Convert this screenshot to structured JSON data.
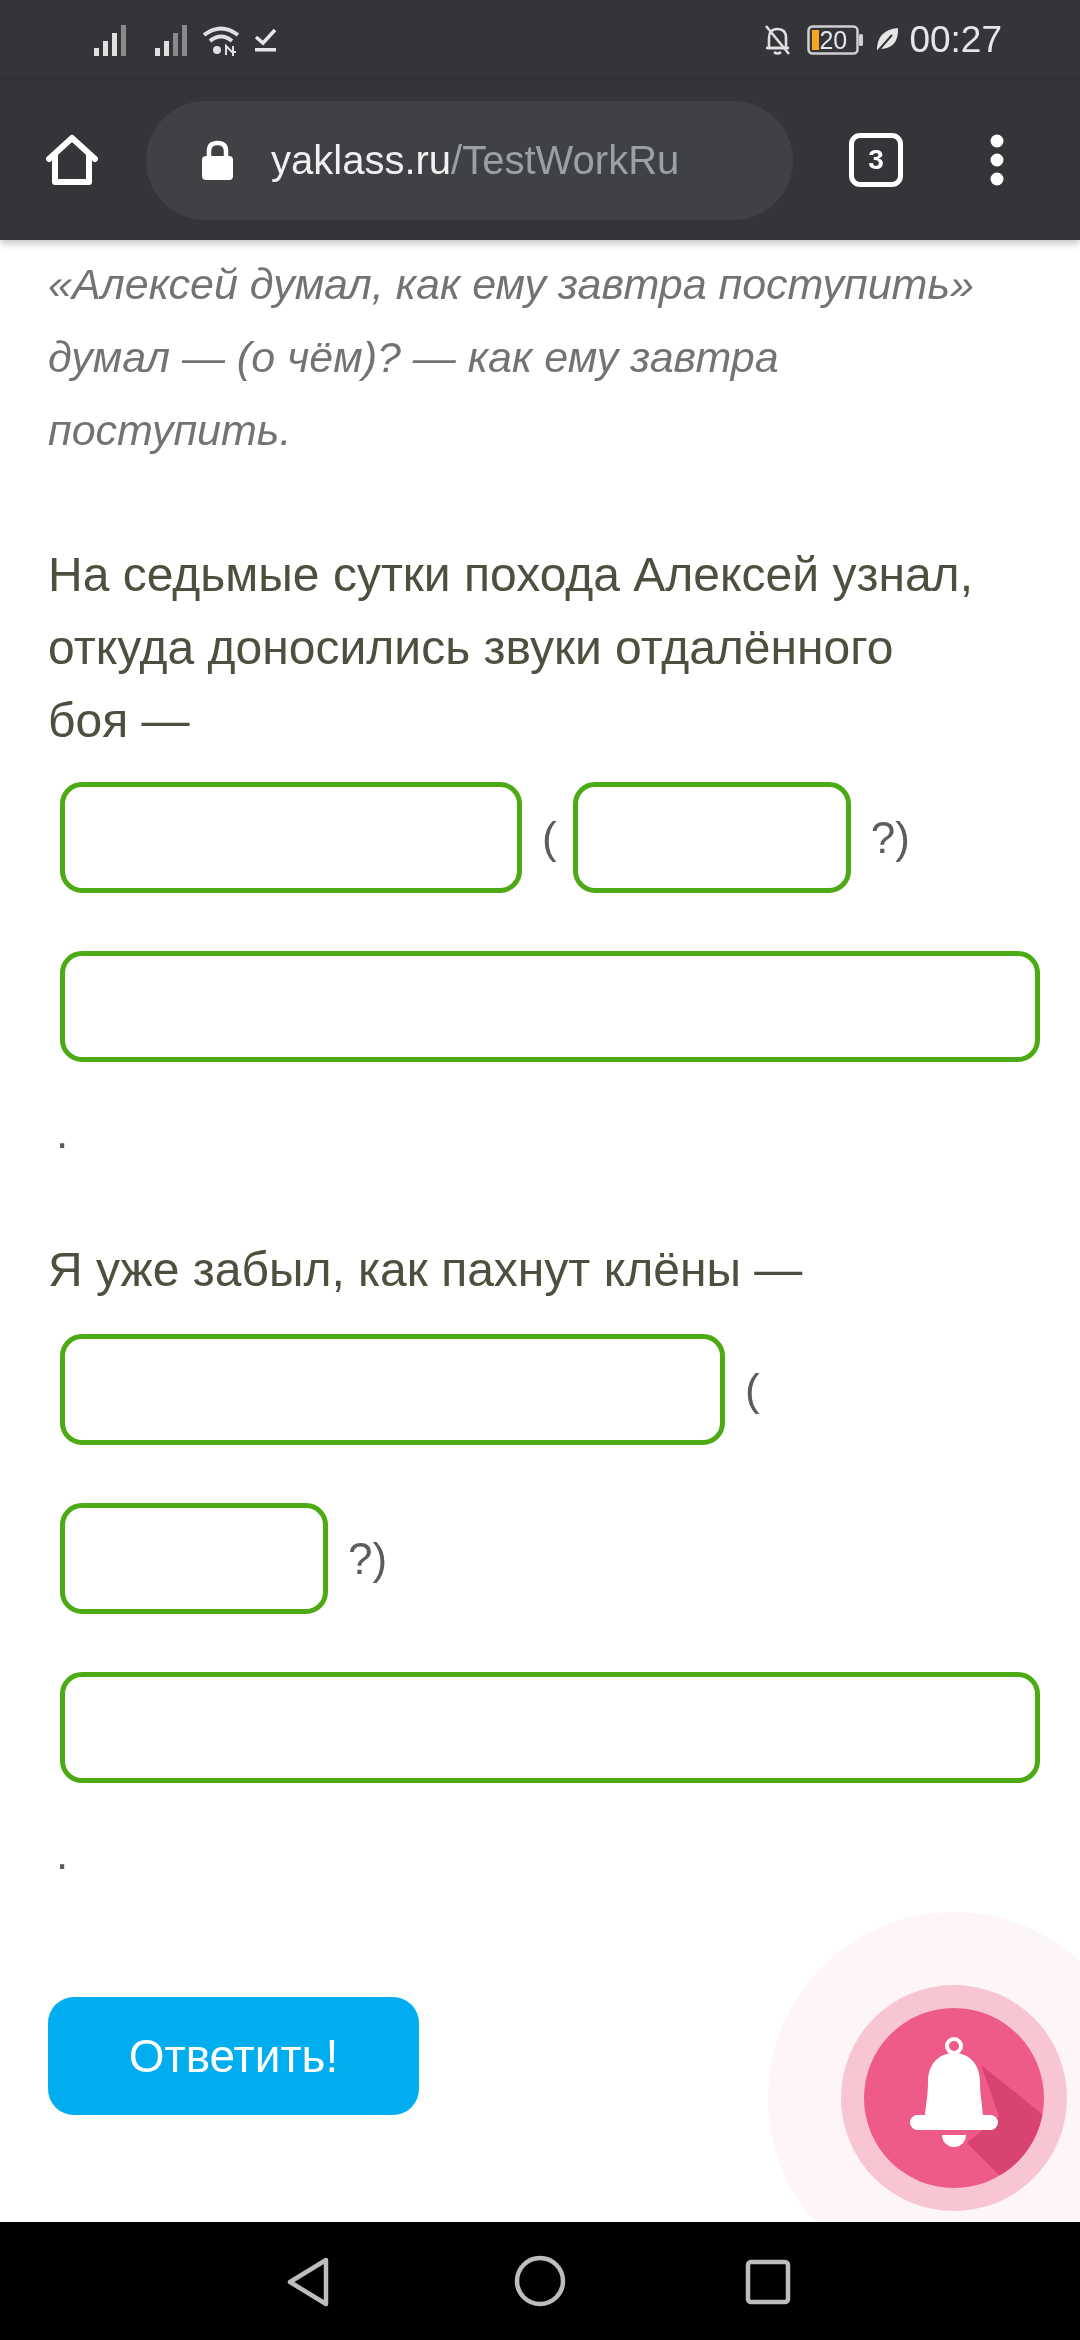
{
  "status_bar": {
    "battery_text": "20",
    "time": "00:27"
  },
  "browser": {
    "url_domain": "yaklass.ru",
    "url_path": "/TestWorkRu",
    "tab_count": "3"
  },
  "explanation": {
    "example": "«Алексей думал, как ему завтра поступить»",
    "analysis": "думал — (о чём)? — как ему завтра поступить."
  },
  "questions": [
    {
      "text": "На седьмые сутки похода Алексей узнал, откуда доносились звуки отдалённого боя —",
      "parts": [
        {
          "kind": "field"
        },
        {
          "kind": "text",
          "text": "("
        },
        {
          "kind": "field"
        },
        {
          "kind": "text",
          "text": "?)"
        },
        {
          "kind": "field"
        },
        {
          "kind": "text",
          "text": "."
        }
      ]
    },
    {
      "text": "Я уже забыл, как пахнут клёны —",
      "parts": [
        {
          "kind": "field"
        },
        {
          "kind": "text",
          "text": "("
        },
        {
          "kind": "field"
        },
        {
          "kind": "text",
          "text": "?)"
        },
        {
          "kind": "field"
        },
        {
          "kind": "text",
          "text": "."
        }
      ]
    }
  ],
  "submit_button": "Ответить!"
}
